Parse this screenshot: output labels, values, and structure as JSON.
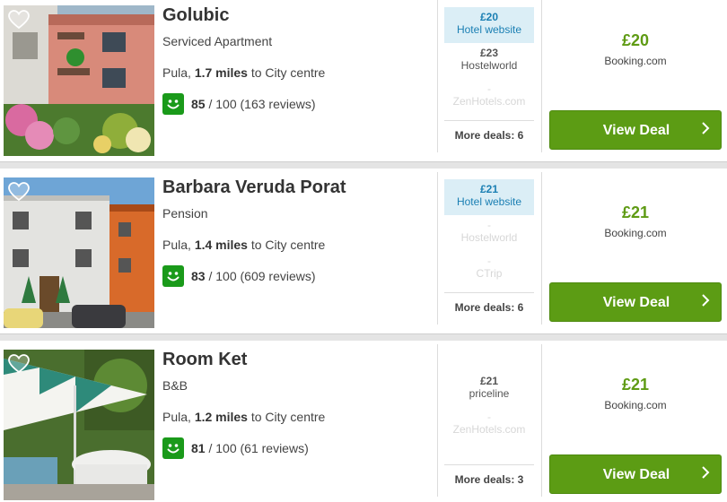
{
  "listings": [
    {
      "name": "Golubic",
      "type": "Serviced Apartment",
      "location_city": "Pula",
      "distance": "1.7 miles",
      "distance_suffix": "to City centre",
      "score": "85",
      "score_suffix": "/ 100 (163 reviews)",
      "deals": [
        {
          "price": "£20",
          "site": "Hotel website",
          "style": "hl"
        },
        {
          "price": "£23",
          "site": "Hostelworld",
          "style": "normal"
        },
        {
          "price": "-",
          "site": "ZenHotels.com",
          "style": "dim"
        }
      ],
      "more_deals": "More deals: 6",
      "best_price": "£20",
      "best_site": "Booking.com",
      "cta": "View Deal"
    },
    {
      "name": "Barbara Veruda Porat",
      "type": "Pension",
      "location_city": "Pula",
      "distance": "1.4 miles",
      "distance_suffix": "to City centre",
      "score": "83",
      "score_suffix": "/ 100 (609 reviews)",
      "deals": [
        {
          "price": "£21",
          "site": "Hotel website",
          "style": "hl"
        },
        {
          "price": "-",
          "site": "Hostelworld",
          "style": "dim"
        },
        {
          "price": "-",
          "site": "CTrip",
          "style": "dim"
        }
      ],
      "more_deals": "More deals: 6",
      "best_price": "£21",
      "best_site": "Booking.com",
      "cta": "View Deal"
    },
    {
      "name": "Room Ket",
      "type": "B&B",
      "location_city": "Pula",
      "distance": "1.2 miles",
      "distance_suffix": "to City centre",
      "score": "81",
      "score_suffix": "/ 100 (61 reviews)",
      "deals": [
        {
          "price": "£21",
          "site": "priceline",
          "style": "normal"
        },
        {
          "price": "-",
          "site": "ZenHotels.com",
          "style": "dim"
        }
      ],
      "more_deals": "More deals: 3",
      "best_price": "£21",
      "best_site": "Booking.com",
      "cta": "View Deal"
    }
  ],
  "icons": {
    "favourite": "heart-icon",
    "rating": "smiley-icon",
    "cta_arrow": "chevron-right-icon"
  },
  "colors": {
    "brand_green": "#5c9c14",
    "price_green": "#5f9b14",
    "rating_green": "#1a9a1a",
    "highlight_blue": "#1a7fb3",
    "highlight_bg": "#dbeef6"
  }
}
